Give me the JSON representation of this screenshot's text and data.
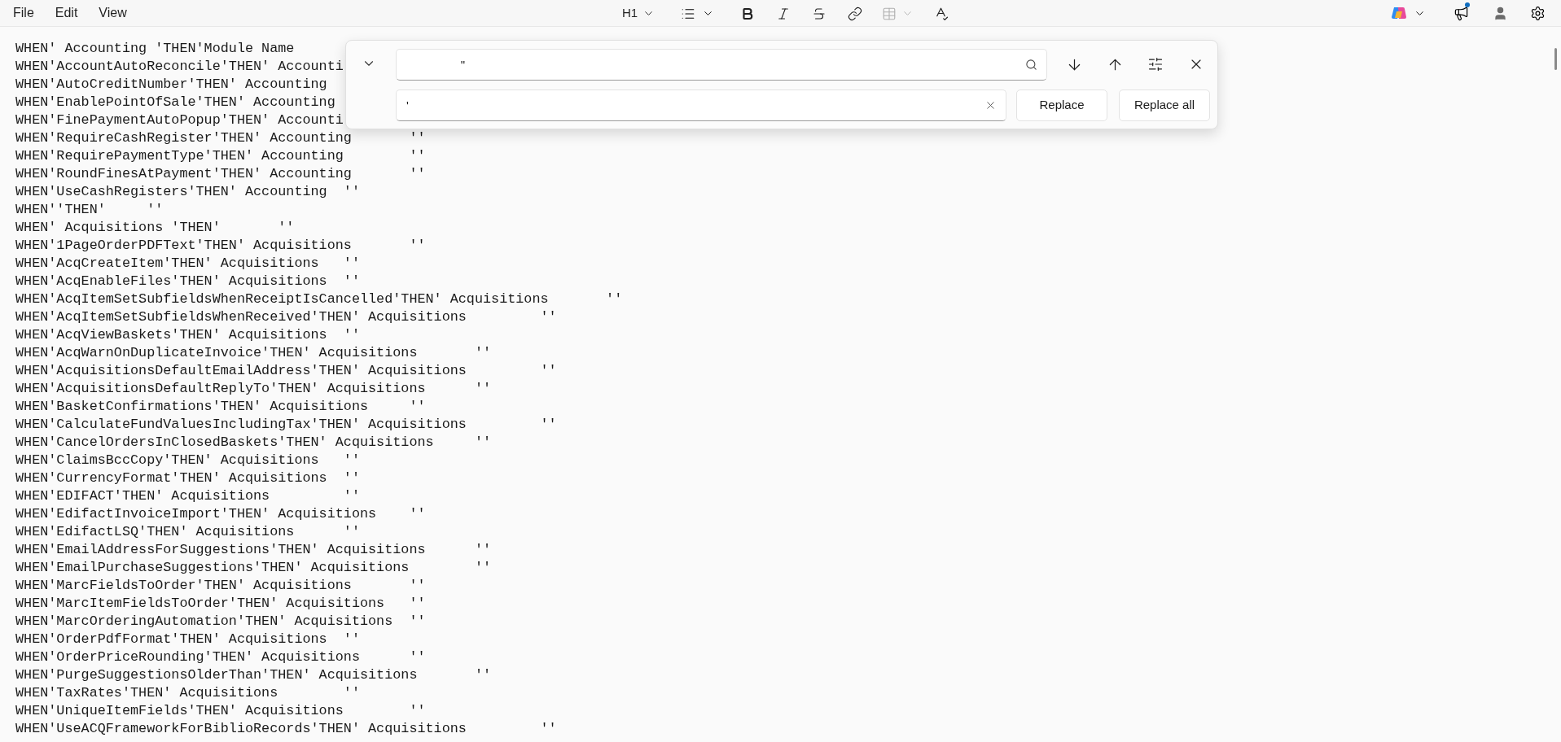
{
  "menu": [
    "File",
    "Edit",
    "View"
  ],
  "toolbar": {
    "heading_style": "H1"
  },
  "lines": [
    "WHEN' Accounting 'THEN'Module Name",
    "WHEN'AccountAutoReconcile'THEN' Accounti",
    "WHEN'AutoCreditNumber'THEN' Accounting",
    "WHEN'EnablePointOfSale'THEN' Accounting",
    "WHEN'FinePaymentAutoPopup'THEN' Accounti",
    "WHEN'RequireCashRegister'THEN' Accounting\t''",
    "WHEN'RequirePaymentType'THEN' Accounting\t''",
    "WHEN'RoundFinesAtPayment'THEN' Accounting\t''",
    "WHEN'UseCashRegisters'THEN' Accounting\t''",
    "WHEN''THEN'\t''",
    "WHEN' Acquisitions 'THEN'\t''",
    "WHEN'1PageOrderPDFText'THEN' Acquisitions\t''",
    "WHEN'AcqCreateItem'THEN' Acquisitions\t''",
    "WHEN'AcqEnableFiles'THEN' Acquisitions\t''",
    "WHEN'AcqItemSetSubfieldsWhenReceiptIsCancelled'THEN' Acquisitions\t''",
    "WHEN'AcqItemSetSubfieldsWhenReceived'THEN' Acquisitions\t\t''",
    "WHEN'AcqViewBaskets'THEN' Acquisitions\t''",
    "WHEN'AcqWarnOnDuplicateInvoice'THEN' Acquisitions\t''",
    "WHEN'AcquisitionsDefaultEmailAddress'THEN' Acquisitions\t\t''",
    "WHEN'AcquisitionsDefaultReplyTo'THEN' Acquisitions\t''",
    "WHEN'BasketConfirmations'THEN' Acquisitions\t''",
    "WHEN'CalculateFundValuesIncludingTax'THEN' Acquisitions\t\t''",
    "WHEN'CancelOrdersInClosedBaskets'THEN' Acquisitions\t''",
    "WHEN'ClaimsBccCopy'THEN' Acquisitions\t''",
    "WHEN'CurrencyFormat'THEN' Acquisitions\t''",
    "WHEN'EDIFACT'THEN' Acquisitions\t\t''",
    "WHEN'EdifactInvoiceImport'THEN' Acquisitions\t''",
    "WHEN'EdifactLSQ'THEN' Acquisitions\t''",
    "WHEN'EmailAddressForSuggestions'THEN' Acquisitions\t''",
    "WHEN'EmailPurchaseSuggestions'THEN' Acquisitions\t''",
    "WHEN'MarcFieldsToOrder'THEN' Acquisitions\t''",
    "WHEN'MarcItemFieldsToOrder'THEN' Acquisitions\t''",
    "WHEN'MarcOrderingAutomation'THEN' Acquisitions\t''",
    "WHEN'OrderPdfFormat'THEN' Acquisitions\t''",
    "WHEN'OrderPriceRounding'THEN' Acquisitions\t''",
    "WHEN'PurgeSuggestionsOlderThan'THEN' Acquisitions\t''",
    "WHEN'TaxRates'THEN' Acquisitions\t''",
    "WHEN'UniqueItemFields'THEN' Acquisitions\t''",
    "WHEN'UseACQFrameworkForBiblioRecords'THEN' Acquisitions\t\t''"
  ],
  "find_panel": {
    "find_value": "                \"",
    "replace_value": "'",
    "buttons": [
      "Replace",
      "Replace all"
    ]
  }
}
